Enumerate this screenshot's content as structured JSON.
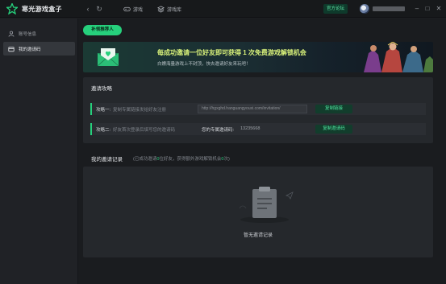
{
  "titlebar": {
    "app_name": "寒光游戏盒子",
    "tabs": [
      {
        "label": "游戏",
        "icon": "gamepad-icon"
      },
      {
        "label": "游戏库",
        "icon": "library-icon"
      }
    ],
    "official_forum": "官方论坛",
    "window_buttons": [
      "minimize-icon",
      "maximize-icon",
      "close-icon"
    ]
  },
  "sidebar": {
    "items": [
      {
        "label": "账号信息",
        "icon": "user-icon",
        "active": false
      },
      {
        "label": "我的邀请码",
        "icon": "invite-code-icon",
        "active": true
      }
    ]
  },
  "main": {
    "recommend_pill": "补领推荐人",
    "banner": {
      "headline": "每成功邀请一位好友即可获得 1 次免费游戏解锁机会",
      "subtitle": "白嫖海量游戏上不封顶，快去邀请好友来玩吧！"
    },
    "strategy": {
      "title": "邀请攻略",
      "rows": [
        {
          "label": "攻略一:",
          "desc": "复制专属链接发给好友注册",
          "link_value": "http://hgxghd.hanguangyouxi.com/invitation/",
          "button": "复制链接"
        },
        {
          "label": "攻略二:",
          "desc": "好友首次登录后填写您的邀请码",
          "code_label": "您的专属邀请码:",
          "code_value": "13235668",
          "button": "复制邀请码"
        }
      ]
    },
    "records": {
      "title": "我的邀请记录",
      "note_prefix": "(已成功邀请",
      "invited_count": "0",
      "note_middle": "位好友，获得额外游戏解锁机会",
      "bonus_count": "0",
      "note_suffix": "次)",
      "empty_text": "暂无邀请记录"
    }
  },
  "colors": {
    "accent": "#26d07c",
    "background": "#1a1c1f",
    "card": "#25282c",
    "banner_headline": "#d9f27a"
  }
}
